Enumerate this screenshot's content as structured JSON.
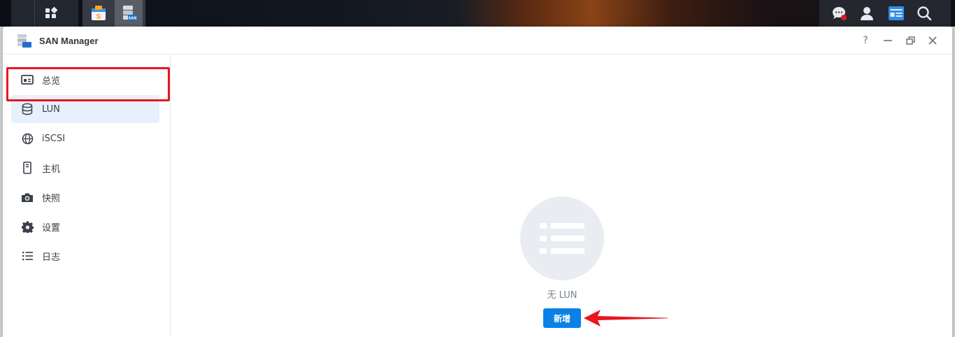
{
  "taskbar": {
    "main_menu_icon": "grid-icon",
    "apps": [
      {
        "name": "package-center-icon"
      },
      {
        "name": "san-manager-icon",
        "badge": "SAN"
      }
    ],
    "right_icons": [
      "chat-icon",
      "user-icon",
      "widgets-icon",
      "search-icon"
    ],
    "notification_color": "#e8161f"
  },
  "window": {
    "title": "SAN Manager",
    "controls": [
      "?",
      "—",
      "❐",
      "✕"
    ]
  },
  "sidebar": {
    "items": [
      {
        "label": "总览",
        "icon": "overview-icon"
      },
      {
        "label": "LUN",
        "icon": "database-icon",
        "active": true
      },
      {
        "label": "iSCSI",
        "icon": "globe-icon"
      },
      {
        "label": "主机",
        "icon": "host-icon"
      },
      {
        "label": "快照",
        "icon": "camera-icon"
      },
      {
        "label": "设置",
        "icon": "gear-icon"
      },
      {
        "label": "日志",
        "icon": "list-icon"
      }
    ]
  },
  "main": {
    "empty_text": "无 LUN",
    "add_button": "新增",
    "empty_icon": "list-icon"
  },
  "colors": {
    "accent": "#0b80e6",
    "highlight": "#e8161f",
    "active_bg": "#e6f1fd"
  }
}
